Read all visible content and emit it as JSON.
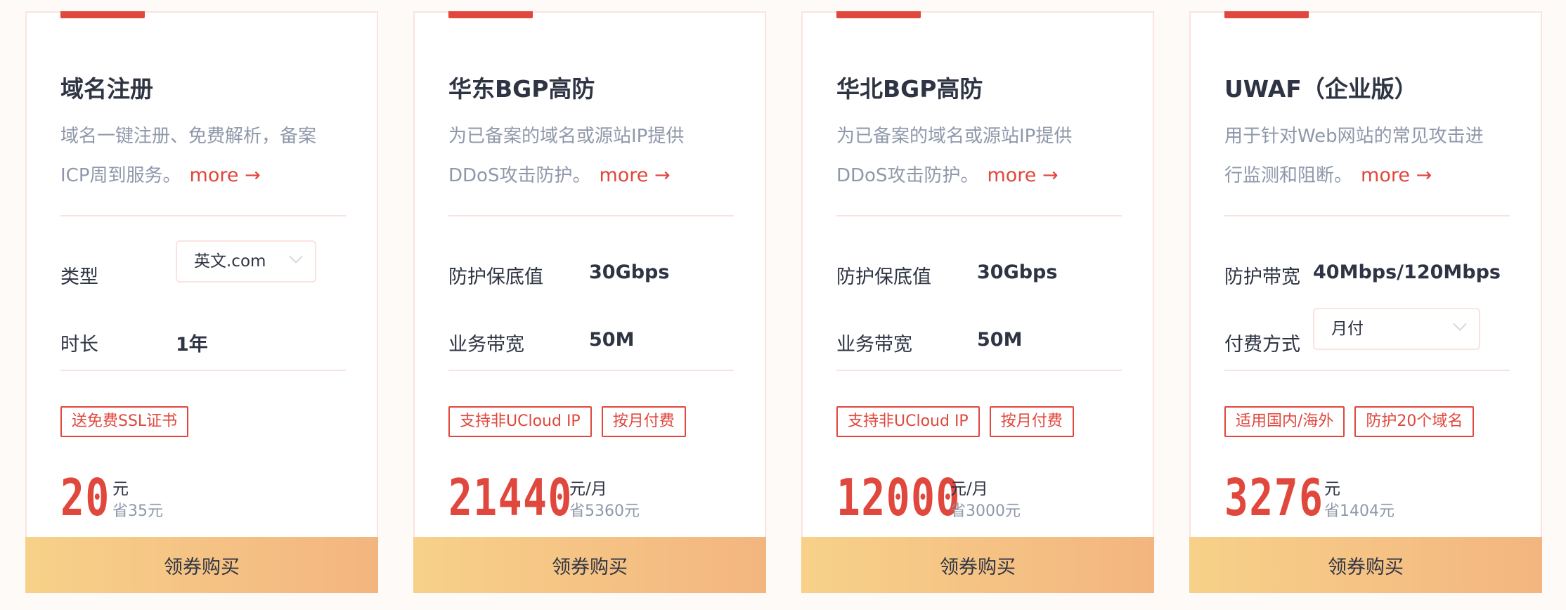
{
  "more_label": "more",
  "arrow": "→",
  "buy_label": "领券购买",
  "cards": [
    {
      "title": "域名注册",
      "desc_lines": [
        "域名一键注册、免费解析，备案",
        "ICP周到服务。"
      ],
      "spec1_label": "类型",
      "spec1_select": "英文.com",
      "spec2_label": "时长",
      "spec2_value": "1年",
      "tags": [
        "送免费SSL证书"
      ],
      "price": "20",
      "unit": "元",
      "save": "省35元"
    },
    {
      "title": "华东BGP高防",
      "desc_lines": [
        "为已备案的域名或源站IP提供",
        "DDoS攻击防护。"
      ],
      "spec1_label": "防护保底值",
      "spec1_value": "30Gbps",
      "spec2_label": "业务带宽",
      "spec2_value": "50M",
      "tags": [
        "支持非UCloud IP",
        "按月付费"
      ],
      "price": "21440",
      "unit": "元/月",
      "save": "省5360元"
    },
    {
      "title": "华北BGP高防",
      "desc_lines": [
        "为已备案的域名或源站IP提供",
        "DDoS攻击防护。"
      ],
      "spec1_label": "防护保底值",
      "spec1_value": "30Gbps",
      "spec2_label": "业务带宽",
      "spec2_value": "50M",
      "tags": [
        "支持非UCloud IP",
        "按月付费"
      ],
      "price": "12000",
      "unit": "元/月",
      "save": "省3000元"
    },
    {
      "title": "UWAF（企业版）",
      "desc_lines": [
        "用于针对Web网站的常见攻击进",
        "行监测和阻断。"
      ],
      "spec1_label": "防护带宽",
      "spec1_value": "40Mbps/120Mbps",
      "spec2_label": "付费方式",
      "spec2_select": "月付",
      "tags": [
        "适用国内/海外",
        "防护20个域名"
      ],
      "price": "3276",
      "unit": "元",
      "save": "省1404元"
    }
  ],
  "colors": {
    "accent": "#e0473d",
    "title": "#2e3443",
    "muted": "#8f98aa",
    "button_gradient_start": "#f7d189",
    "button_gradient_end": "#f3b57f"
  }
}
